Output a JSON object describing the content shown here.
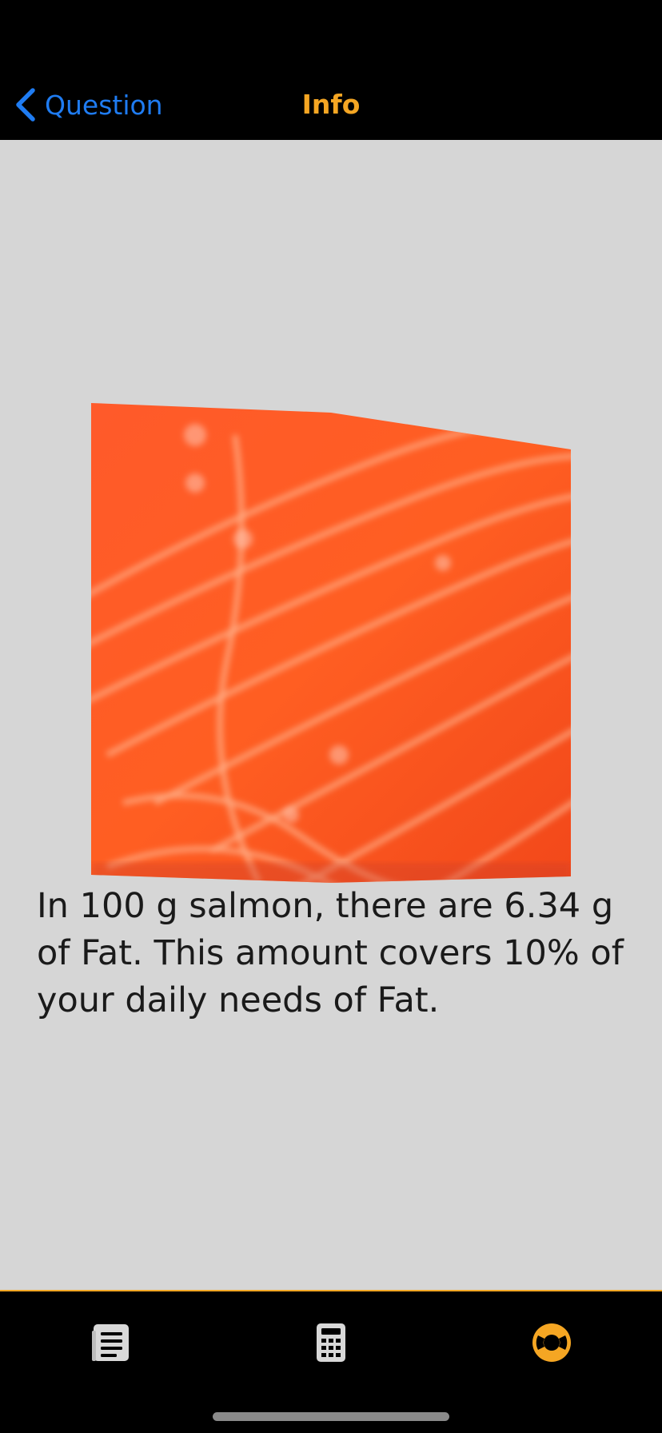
{
  "navbar": {
    "back_label": "Question",
    "title": "Info",
    "back_color": "#1f7cf2",
    "title_color": "#f5a623"
  },
  "content": {
    "image_subject": "salmon",
    "info_text": "In 100 g salmon, there are 6.34 g of Fat. This amount covers 10% of your daily needs of Fat."
  },
  "tabbar": {
    "accent_color": "#f5a623",
    "tabs": [
      {
        "icon": "list-icon",
        "active": false
      },
      {
        "icon": "calculator-icon",
        "active": false
      },
      {
        "icon": "lifebuoy-icon",
        "active": true
      }
    ]
  }
}
